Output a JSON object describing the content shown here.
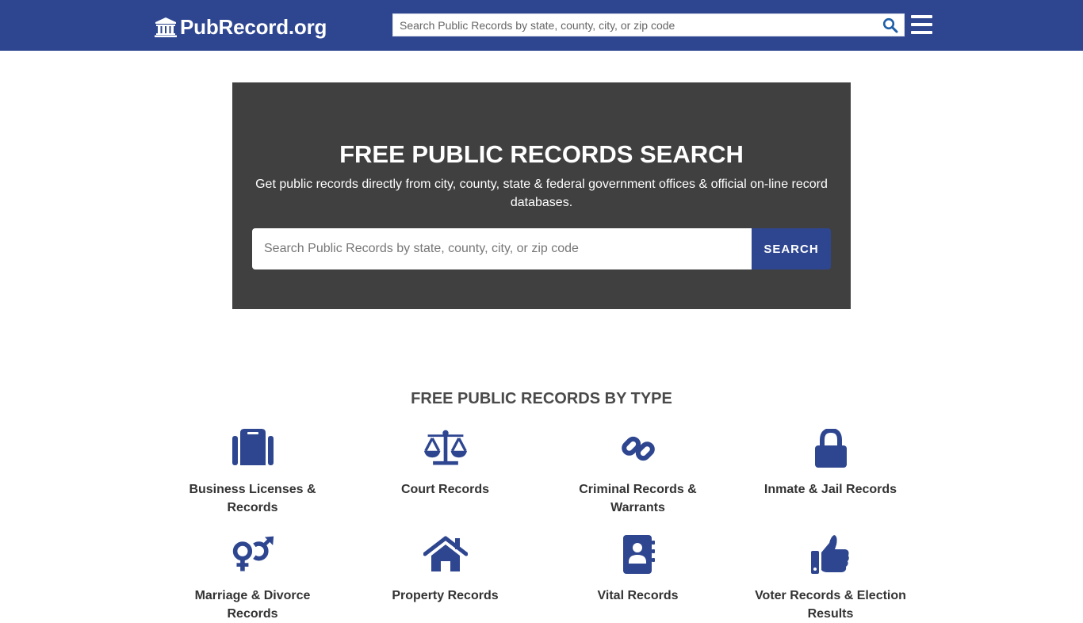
{
  "header": {
    "logo_text": "PubRecord.org",
    "search_placeholder": "Search Public Records by state, county, city, or zip code",
    "search_value": "",
    "colors": {
      "brand": "#2e4690",
      "hero_bg": "#404040",
      "text_dark": "#333333"
    }
  },
  "hero": {
    "title": "FREE PUBLIC RECORDS SEARCH",
    "subtitle": "Get public records directly from city, county, state & federal government offices & official on-line record databases.",
    "search_placeholder": "Search Public Records by state, county, city, or zip code",
    "search_value": "",
    "search_button": "SEARCH"
  },
  "types": {
    "title": "FREE PUBLIC RECORDS BY TYPE",
    "items": [
      {
        "label": "Business Licenses & Records",
        "icon": "suitcase-icon"
      },
      {
        "label": "Court Records",
        "icon": "balance-scale-icon"
      },
      {
        "label": "Criminal Records & Warrants",
        "icon": "link-icon"
      },
      {
        "label": "Inmate & Jail Records",
        "icon": "lock-icon"
      },
      {
        "label": "Marriage & Divorce Records",
        "icon": "venus-mars-icon"
      },
      {
        "label": "Property Records",
        "icon": "home-icon"
      },
      {
        "label": "Vital Records",
        "icon": "address-book-icon"
      },
      {
        "label": "Voter Records & Election Results",
        "icon": "thumbs-up-icon"
      }
    ]
  }
}
